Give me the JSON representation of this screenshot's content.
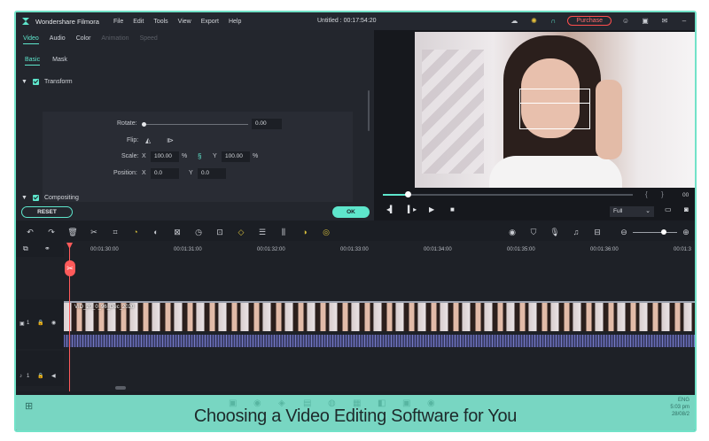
{
  "app": {
    "name": "Wondershare Filmora",
    "document_title": "Untitled : 00:17:54:20",
    "menu": [
      "File",
      "Edit",
      "Tools",
      "View",
      "Export",
      "Help"
    ],
    "purchase_label": "Purchase",
    "accent_color": "#5ee6cc",
    "purchase_color": "#ff4d4d"
  },
  "editor": {
    "tabs": [
      {
        "label": "Video",
        "state": "active"
      },
      {
        "label": "Audio",
        "state": "normal"
      },
      {
        "label": "Color",
        "state": "normal"
      },
      {
        "label": "Animation",
        "state": "disabled"
      },
      {
        "label": "Speed",
        "state": "disabled"
      }
    ],
    "subtabs": [
      "Basic",
      "Mask"
    ],
    "transform_label": "Transform",
    "compositing_label": "Compositing",
    "rotate_label": "Rotate:",
    "rotate_value": "0.00",
    "rotate_level": 0,
    "flip_label": "Flip:",
    "scale_label": "Scale:",
    "scale_x_label": "X",
    "scale_x_value": "100.00",
    "scale_y_label": "Y",
    "scale_y_value": "100.00",
    "percent_unit": "%",
    "position_label": "Position:",
    "position_x_label": "X",
    "position_x_value": "0.0",
    "position_y_label": "Y",
    "position_y_value": "0.0",
    "reset_label": "RESET",
    "ok_label": "OK"
  },
  "preview": {
    "progress": 0.1,
    "marker_in": "{",
    "marker_out": "}",
    "time_display": "00",
    "quality_value": "Full"
  },
  "timeline": {
    "ruler_ticks": [
      "00:01:30:00",
      "00:01:31:00",
      "00:01:32:00",
      "00:01:33:00",
      "00:01:34:00",
      "00:01:35:00",
      "00:01:36:00",
      "00:01:3"
    ],
    "video_track_number": "1",
    "audio_track_number": "1",
    "clip_name": "VID_20_0_96_Dec_2020",
    "zoom_level": 0.7
  },
  "caption": "Choosing a Video Editing Software for You",
  "tray": {
    "time": "5:03 pm",
    "date": "28/08/2",
    "language": "ENG"
  }
}
